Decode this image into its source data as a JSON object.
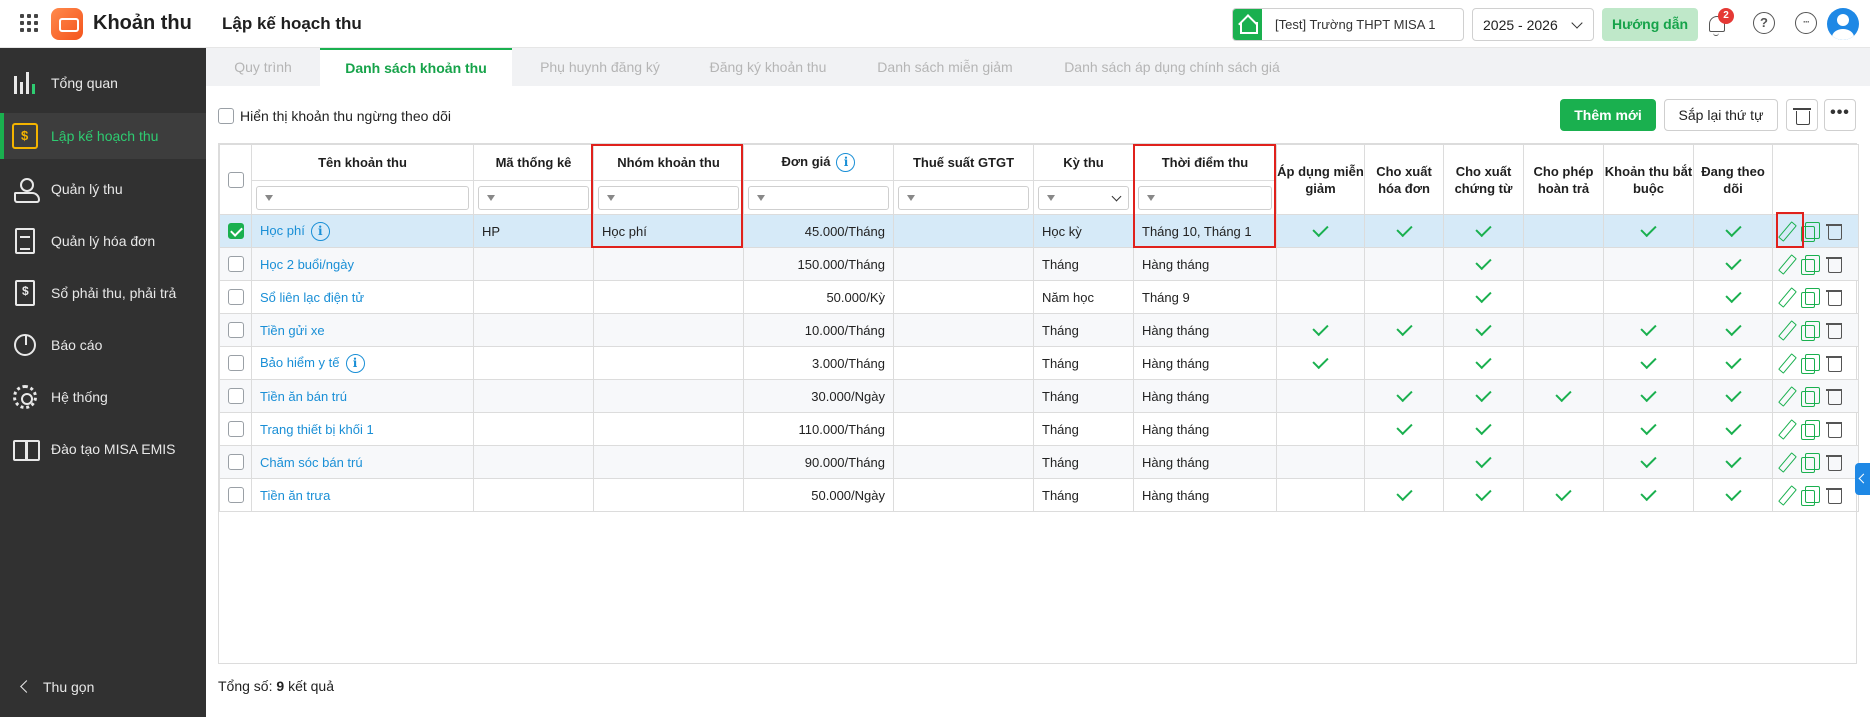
{
  "app": {
    "title": "Khoản thu",
    "page_title": "Lập kế hoạch thu"
  },
  "header": {
    "school": "[Test] Trường THPT MISA 1",
    "year": "2025 - 2026",
    "guide_label": "Hướng dẫn",
    "notification_count": "2",
    "help_glyph": "?",
    "more_glyph": "···"
  },
  "sidebar": {
    "items": [
      {
        "label": "Tổng quan",
        "icon": "chart-bars-icon"
      },
      {
        "label": "Lập kế hoạch thu",
        "icon": "calendar-money-icon",
        "active": true
      },
      {
        "label": "Quản lý thu",
        "icon": "hand-coin-icon"
      },
      {
        "label": "Quản lý hóa đơn",
        "icon": "invoice-icon"
      },
      {
        "label": "Sổ phải thu, phải trả",
        "icon": "ledger-icon"
      },
      {
        "label": "Báo cáo",
        "icon": "pie-chart-icon"
      },
      {
        "label": "Hệ thống",
        "icon": "gear-icon"
      },
      {
        "label": "Đào tạo MISA EMIS",
        "icon": "open-book-icon"
      }
    ],
    "collapse_label": "Thu gọn"
  },
  "tabs": [
    "Quy trình",
    "Danh sách khoản thu",
    "Phụ huynh đăng ký",
    "Đăng ký khoản thu",
    "Danh sách miễn giảm",
    "Danh sách áp dụng chính sách giá"
  ],
  "toolbar": {
    "show_inactive_label": "Hiển thị khoản thu ngừng theo dõi",
    "add_label": "Thêm mới",
    "sort_label": "Sắp lại thứ tự",
    "more_glyph": "•••"
  },
  "table": {
    "headers": {
      "name": "Tên khoản thu",
      "code": "Mã thống kê",
      "group": "Nhóm khoản thu",
      "price": "Đơn giá",
      "vat": "Thuế suất GTGT",
      "period": "Kỳ thu",
      "time": "Thời điểm thu",
      "discount": "Áp dụng miễn giảm",
      "invoice": "Cho xuất hóa đơn",
      "voucher": "Cho xuất chứng từ",
      "refund": "Cho phép hoàn trả",
      "mandatory": "Khoản thu bắt buộc",
      "tracking": "Đang theo dõi"
    },
    "info_glyph": "i",
    "rows": [
      {
        "name": "Học phí",
        "info": true,
        "code": "HP",
        "group": "Học phí",
        "price": "45.000/Tháng",
        "vat": "",
        "period": "Học kỳ",
        "time": "Tháng 10, Tháng 1",
        "discount": true,
        "invoice": true,
        "voucher": true,
        "refund": false,
        "mandatory": true,
        "tracking": true,
        "selected": true
      },
      {
        "name": "Học 2 buổi/ngày",
        "info": false,
        "code": "",
        "group": "",
        "price": "150.000/Tháng",
        "vat": "",
        "period": "Tháng",
        "time": "Hàng tháng",
        "discount": false,
        "invoice": false,
        "voucher": true,
        "refund": false,
        "mandatory": false,
        "tracking": true
      },
      {
        "name": "Sổ liên lạc điện tử",
        "info": false,
        "code": "",
        "group": "",
        "price": "50.000/Kỳ",
        "vat": "",
        "period": "Năm học",
        "time": "Tháng 9",
        "discount": false,
        "invoice": false,
        "voucher": true,
        "refund": false,
        "mandatory": false,
        "tracking": true
      },
      {
        "name": "Tiền gửi xe",
        "info": false,
        "code": "",
        "group": "",
        "price": "10.000/Tháng",
        "vat": "",
        "period": "Tháng",
        "time": "Hàng tháng",
        "discount": true,
        "invoice": true,
        "voucher": true,
        "refund": false,
        "mandatory": true,
        "tracking": true
      },
      {
        "name": "Bảo hiểm y tế",
        "info": true,
        "code": "",
        "group": "",
        "price": "3.000/Tháng",
        "vat": "",
        "period": "Tháng",
        "time": "Hàng tháng",
        "discount": true,
        "invoice": false,
        "voucher": true,
        "refund": false,
        "mandatory": true,
        "tracking": true
      },
      {
        "name": "Tiền ăn bán trú",
        "info": false,
        "code": "",
        "group": "",
        "price": "30.000/Ngày",
        "vat": "",
        "period": "Tháng",
        "time": "Hàng tháng",
        "discount": false,
        "invoice": true,
        "voucher": true,
        "refund": true,
        "mandatory": true,
        "tracking": true
      },
      {
        "name": "Trang thiết bị khối 1",
        "info": false,
        "code": "",
        "group": "",
        "price": "110.000/Tháng",
        "vat": "",
        "period": "Tháng",
        "time": "Hàng tháng",
        "discount": false,
        "invoice": true,
        "voucher": true,
        "refund": false,
        "mandatory": true,
        "tracking": true
      },
      {
        "name": "Chăm sóc bán trú",
        "info": false,
        "code": "",
        "group": "",
        "price": "90.000/Tháng",
        "vat": "",
        "period": "Tháng",
        "time": "Hàng tháng",
        "discount": false,
        "invoice": false,
        "voucher": true,
        "refund": false,
        "mandatory": true,
        "tracking": true
      },
      {
        "name": "Tiền ăn trưa",
        "info": false,
        "code": "",
        "group": "",
        "price": "50.000/Ngày",
        "vat": "",
        "period": "Tháng",
        "time": "Hàng tháng",
        "discount": false,
        "invoice": true,
        "voucher": true,
        "refund": true,
        "mandatory": true,
        "tracking": true
      }
    ]
  },
  "footer": {
    "total_prefix": "Tổng số:",
    "total_count": "9",
    "total_suffix": "kết quả"
  },
  "colors": {
    "accent": "#1ab04f",
    "link": "#1a8fd6",
    "highlight": "#e0211c",
    "sidebar_bg": "#313131"
  }
}
